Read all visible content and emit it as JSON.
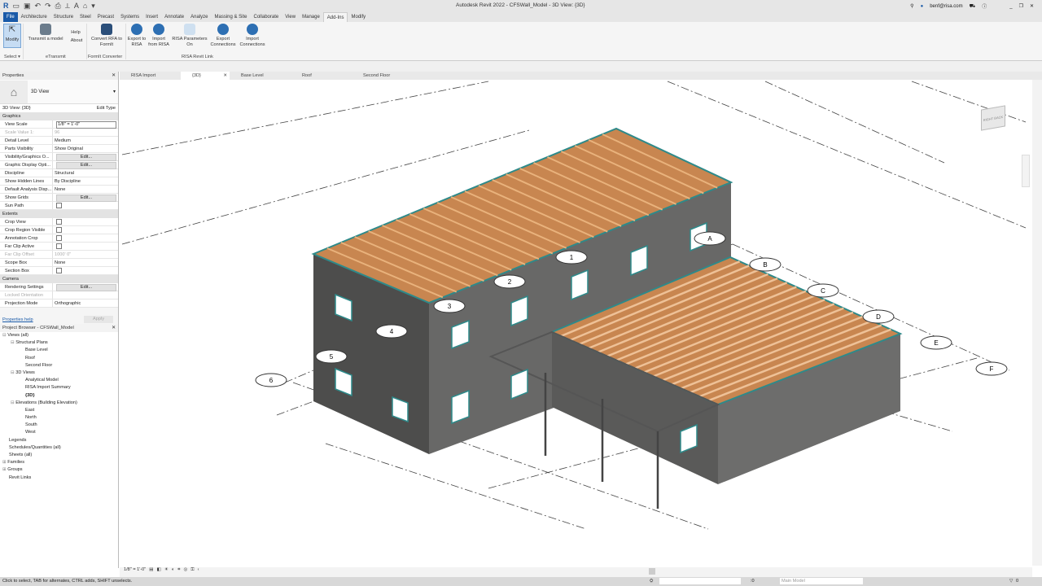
{
  "app": {
    "title": "Autodesk Revit 2022 - CFSWall_Model - 3D View: {3D}",
    "user": "benf@risa.com"
  },
  "ribbon_tabs": [
    "File",
    "Architecture",
    "Structure",
    "Steel",
    "Precast",
    "Systems",
    "Insert",
    "Annotate",
    "Analyze",
    "Massing & Site",
    "Collaborate",
    "View",
    "Manage",
    "Add-Ins",
    "Modify"
  ],
  "active_tab": "Add-Ins",
  "ribbon": {
    "buttons": [
      {
        "label": "Modify",
        "icon": "cursor-icon"
      },
      {
        "label": "Transmit a model",
        "icon": "transmit-icon"
      },
      {
        "label": "Help",
        "icon": "help-icon"
      },
      {
        "label": "About",
        "icon": "about-icon"
      },
      {
        "label": "Convert RFA to FormIt",
        "icon": "formit-icon"
      },
      {
        "label": "Export to RISA",
        "icon": "risa-export-icon"
      },
      {
        "label": "Import from RISA",
        "icon": "risa-import-icon"
      },
      {
        "label": "RISA Parameters On",
        "icon": "risa-parameters-icon"
      },
      {
        "label": "Export Connections",
        "icon": "export-connections-icon"
      },
      {
        "label": "Import Connections",
        "icon": "import-connections-icon"
      }
    ],
    "panels": [
      "Select ▾",
      "eTransmit",
      "FormIt Converter",
      "RISA Revit Link"
    ]
  },
  "properties": {
    "title": "Properties",
    "type": "3D View",
    "selector": "3D View: {3D}",
    "edit_type": "Edit Type",
    "groups": [
      {
        "name": "Graphics",
        "rows": [
          {
            "k": "View Scale",
            "v": "1/8\" = 1'-0\"",
            "kind": "input"
          },
          {
            "k": "Scale Value    1:",
            "v": "96",
            "kind": "disabled"
          },
          {
            "k": "Detail Level",
            "v": "Medium"
          },
          {
            "k": "Parts Visibility",
            "v": "Show Original"
          },
          {
            "k": "Visibility/Graphics O...",
            "v": "Edit...",
            "kind": "button"
          },
          {
            "k": "Graphic Display Opti...",
            "v": "Edit...",
            "kind": "button"
          },
          {
            "k": "Discipline",
            "v": "Structural"
          },
          {
            "k": "Show Hidden Lines",
            "v": "By Discipline"
          },
          {
            "k": "Default Analysis Disp...",
            "v": "None"
          },
          {
            "k": "Show Grids",
            "v": "Edit...",
            "kind": "button"
          },
          {
            "k": "Sun Path",
            "v": "",
            "kind": "check"
          }
        ]
      },
      {
        "name": "Extents",
        "rows": [
          {
            "k": "Crop View",
            "v": "",
            "kind": "check"
          },
          {
            "k": "Crop Region Visible",
            "v": "",
            "kind": "check"
          },
          {
            "k": "Annotation Crop",
            "v": "",
            "kind": "check"
          },
          {
            "k": "Far Clip Active",
            "v": "",
            "kind": "check"
          },
          {
            "k": "Far Clip Offset",
            "v": "1000'  0\"",
            "kind": "disabled"
          },
          {
            "k": "Scope Box",
            "v": "None"
          },
          {
            "k": "Section Box",
            "v": "",
            "kind": "check"
          }
        ]
      },
      {
        "name": "Camera",
        "rows": [
          {
            "k": "Rendering Settings",
            "v": "Edit...",
            "kind": "button"
          },
          {
            "k": "Locked Orientation",
            "v": "",
            "kind": "disabled"
          },
          {
            "k": "Projection Mode",
            "v": "Orthographic"
          }
        ]
      }
    ],
    "help": "Properties help",
    "apply": "Apply"
  },
  "browser": {
    "title": "Project Browser - CFSWall_Model",
    "items": [
      {
        "label": "Views (all)",
        "level": 0,
        "exp": "⊟"
      },
      {
        "label": "Structural Plans",
        "level": 1,
        "exp": "⊟"
      },
      {
        "label": "Base Level",
        "level": 2
      },
      {
        "label": "Roof",
        "level": 2
      },
      {
        "label": "Second Floor",
        "level": 2
      },
      {
        "label": "3D Views",
        "level": 1,
        "exp": "⊟"
      },
      {
        "label": "Analytical Model",
        "level": 2
      },
      {
        "label": "RISA Import Summary",
        "level": 2
      },
      {
        "label": "{3D}",
        "level": 2,
        "bold": true
      },
      {
        "label": "Elevations (Building Elevation)",
        "level": 1,
        "exp": "⊟"
      },
      {
        "label": "East",
        "level": 2
      },
      {
        "label": "North",
        "level": 2
      },
      {
        "label": "South",
        "level": 2
      },
      {
        "label": "West",
        "level": 2
      },
      {
        "label": "Legends",
        "level": 0
      },
      {
        "label": "Schedules/Quantities (all)",
        "level": 0
      },
      {
        "label": "Sheets (all)",
        "level": 0
      },
      {
        "label": "Families",
        "level": 0,
        "exp": "⊞"
      },
      {
        "label": "Groups",
        "level": 0,
        "exp": "⊞"
      },
      {
        "label": "Revit Links",
        "level": 0
      }
    ]
  },
  "view_tabs": [
    {
      "label": "RISA Import Summary"
    },
    {
      "label": "{3D}",
      "active": true
    },
    {
      "label": "Base Level"
    },
    {
      "label": "Roof"
    },
    {
      "label": "Second Floor"
    }
  ],
  "grids": {
    "numbers": [
      "1",
      "2",
      "3",
      "4",
      "5",
      "6"
    ],
    "letters": [
      "A",
      "B",
      "C",
      "D",
      "E",
      "F"
    ]
  },
  "viewcube": {
    "faces": [
      "RIGHT",
      "BACK"
    ]
  },
  "view_control": {
    "scale": "1/8\" = 1'-0\""
  },
  "status": {
    "message": "Click to select, TAB for alternates, CTRL adds, SHIFT unselects.",
    "workset_count": ":0",
    "model": "Main Model",
    "filter_count": "0"
  },
  "colors": {
    "accent": "#1a5aa8",
    "wall": "#5f5f5e",
    "joist": "#d9935a",
    "wall_top": "#2e8a8a"
  }
}
